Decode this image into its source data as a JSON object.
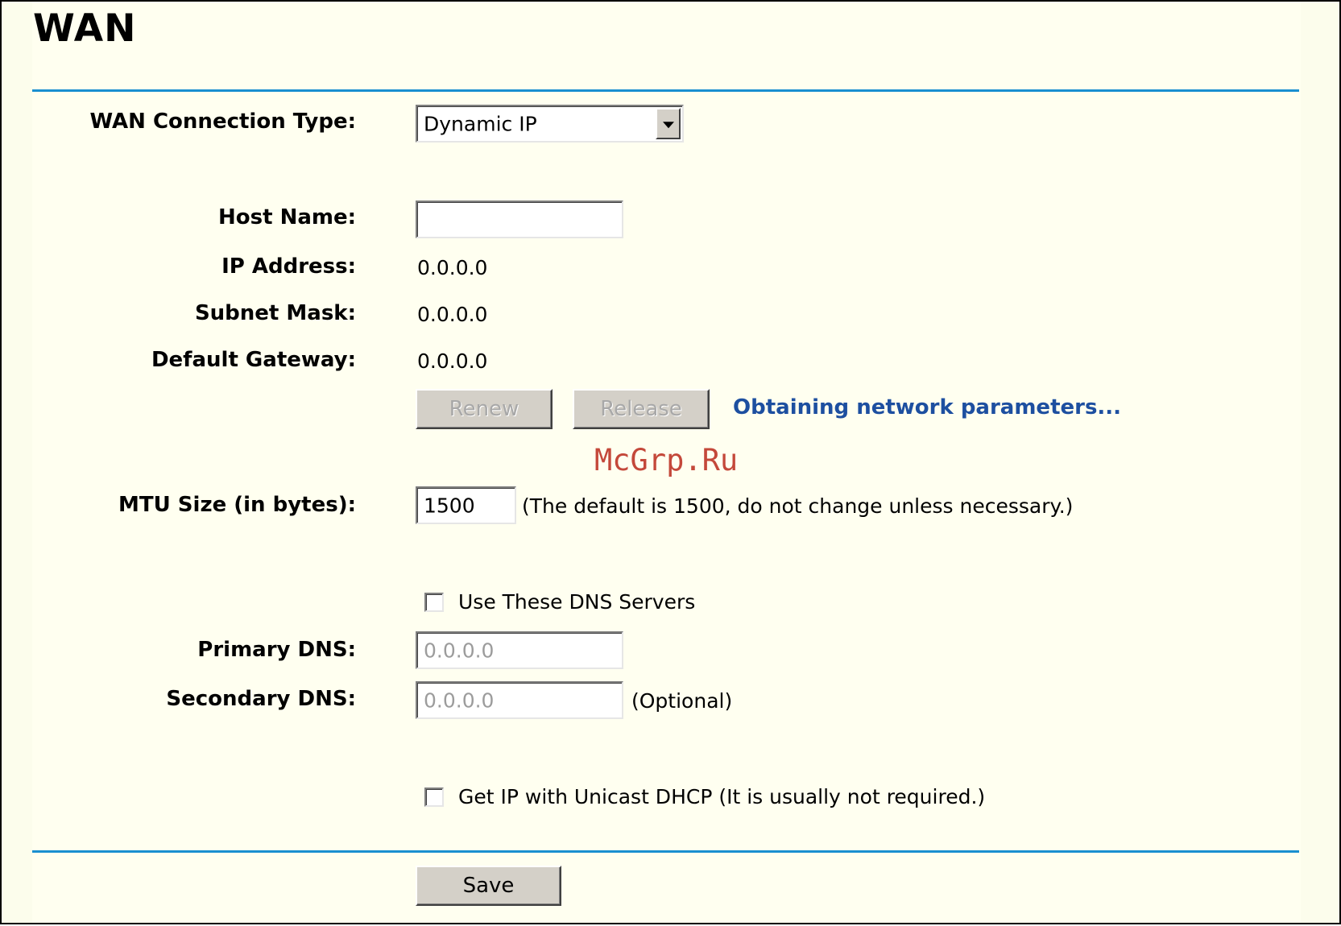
{
  "page": {
    "title": "WAN"
  },
  "form": {
    "connection_type": {
      "label": "WAN Connection Type:",
      "selected": "Dynamic IP"
    },
    "host_name": {
      "label": "Host Name:",
      "value": ""
    },
    "ip_address": {
      "label": "IP Address:",
      "value": "0.0.0.0"
    },
    "subnet_mask": {
      "label": "Subnet Mask:",
      "value": "0.0.0.0"
    },
    "default_gateway": {
      "label": "Default Gateway:",
      "value": "0.0.0.0"
    },
    "renew_label": "Renew",
    "release_label": "Release",
    "status_text": "Obtaining network parameters...",
    "mtu": {
      "label": "MTU Size (in bytes):",
      "value": "1500",
      "hint": "(The default is 1500, do not change unless necessary.)"
    },
    "use_dns": {
      "label": "Use These DNS Servers",
      "checked": false
    },
    "primary_dns": {
      "label": "Primary DNS:",
      "value": "0.0.0.0"
    },
    "secondary_dns": {
      "label": "Secondary DNS:",
      "value": "0.0.0.0",
      "hint": "(Optional)"
    },
    "unicast_dhcp": {
      "label": "Get IP with Unicast DHCP (It is usually not required.)",
      "checked": false
    },
    "save_label": "Save"
  },
  "watermark": "McGrp.Ru",
  "colors": {
    "accent_rule": "#1a8fd0",
    "status_text": "#1d4fa0",
    "background": "#fffff0",
    "watermark": "#c0392b"
  }
}
